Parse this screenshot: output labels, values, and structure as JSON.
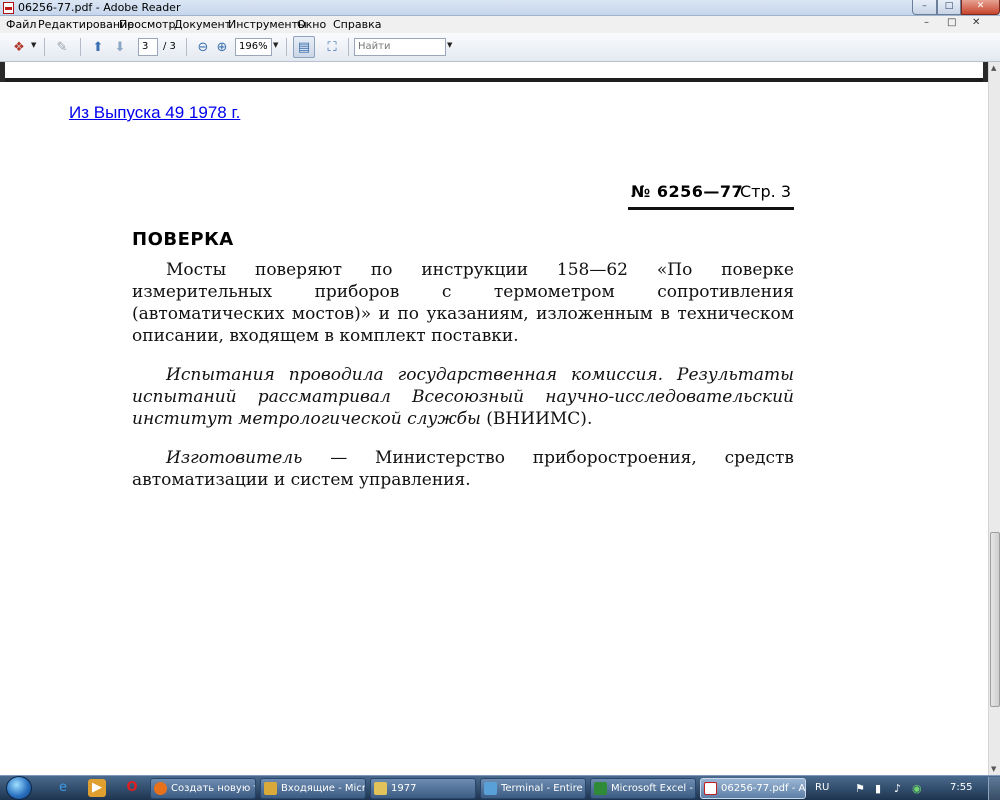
{
  "window": {
    "title": "06256-77.pdf - Adobe Reader",
    "min_glyph": "–",
    "max_glyph": "□",
    "close_glyph": "✕"
  },
  "menu": {
    "items": [
      "Файл",
      "Редактирование",
      "Просмотр",
      "Документ",
      "Инструменты",
      "Окно",
      "Справка"
    ],
    "doc_controls": [
      "–",
      "□",
      "✕"
    ]
  },
  "toolbar": {
    "current_page": "3",
    "total_pages": "/ 3",
    "zoom": "196%",
    "find_placeholder": "Найти"
  },
  "document": {
    "source_link": "Из Выпуска 49 1978 г.",
    "header_number": "№ 6256—77",
    "header_page": "Стр. 3",
    "section_title": "ПОВЕРКА",
    "para1": "Мосты поверяют по инструкции 158—62 «По поверке измерительных приборов с термометром сопротивления (автоматических мостов)» и по указаниям, изложенным в техническом описании, входящем в комплект поставки.",
    "para2_italic": "Испытания проводила государственная комиссия. Результаты испытаний рассматривал Всесоюзный научно-исследовательский институт метрологической службы",
    "para2_upright": "(ВНИИМС).",
    "para3_italic": "Изготовитель",
    "para3_rest": "— Министерство приборостроения, средств автоматизации и систем управления."
  },
  "taskbar": {
    "buttons": [
      {
        "label": "Создать новую т...",
        "color": "#3a2a6b"
      },
      {
        "label": "Входящие - Micr...",
        "color": "#d9a93a"
      },
      {
        "label": "1977",
        "color": "#e2c25a"
      },
      {
        "label": "Terminal - Entire ...",
        "color": "#5aa0d8"
      },
      {
        "label": "Microsoft Excel - ...",
        "color": "#2f8a3a"
      },
      {
        "label": "06256-77.pdf - A...",
        "color": "#c41e1e"
      }
    ],
    "language": "RU",
    "clock": "7:55"
  },
  "icons": {
    "start": "windows-orb-icon",
    "ie": "internet-explorer-icon",
    "media": "media-player-icon",
    "opera": "opera-icon",
    "firefox": "firefox-icon"
  }
}
